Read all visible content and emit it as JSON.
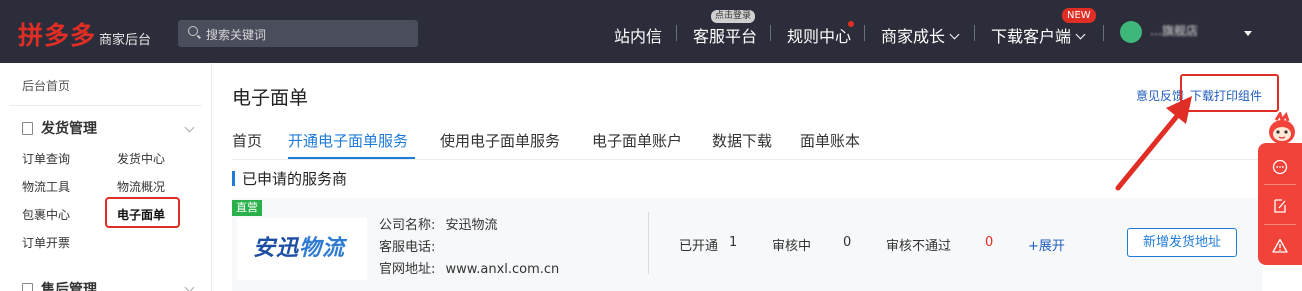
{
  "topbar": {
    "logo": "拼多多",
    "logo_sub": "商家后台",
    "search_placeholder": "搜索关键词",
    "nav": {
      "messages": "站内信",
      "service": "客服平台",
      "service_badge": "点击登录",
      "rules": "规则中心",
      "growth": "商家成长",
      "download_client": "下载客户端",
      "new_badge": "NEW"
    },
    "shop_name": "…旗舰店"
  },
  "sidebar": {
    "home": "后台首页",
    "groups": [
      {
        "title": "发货管理",
        "items": [
          "订单查询",
          "发货中心",
          "物流工具",
          "物流概况",
          "包裹中心",
          "电子面单",
          "订单开票"
        ]
      },
      {
        "title": "售后管理"
      }
    ],
    "active_item": "电子面单"
  },
  "main": {
    "title": "电子面单",
    "feedback": "意见反馈",
    "download_plugin": "下载打印组件",
    "tabs": [
      "首页",
      "开通电子面单服务",
      "使用电子面单服务",
      "电子面单账户",
      "数据下载",
      "面单账本"
    ],
    "active_tab": "开通电子面单服务",
    "section_title": "已申请的服务商",
    "provider": {
      "tag": "直营",
      "logo_part1": "安迅",
      "logo_part2": "物流",
      "company_label": "公司名称:",
      "company_value": "安迅物流",
      "phone_label": "客服电话:",
      "phone_value": "",
      "website_label": "官网地址:",
      "website_value": "www.anxl.com.cn",
      "opened_label": "已开通",
      "opened_value": "1",
      "reviewing_label": "审核中",
      "reviewing_value": "0",
      "rejected_label": "审核不通过",
      "rejected_value": "0",
      "expand": "+展开",
      "add_address_button": "新增发货地址"
    }
  },
  "colors": {
    "topbar_bg": "#2b2d3a",
    "brand_red": "#e02e24",
    "link_blue": "#1f7bd8",
    "tag_green": "#2ab04a"
  },
  "icons": [
    "search-icon",
    "doc-icon",
    "checkbox-icon",
    "chevron-down-icon",
    "chat-icon",
    "edit-icon",
    "warning-icon",
    "mascot-icon"
  ]
}
